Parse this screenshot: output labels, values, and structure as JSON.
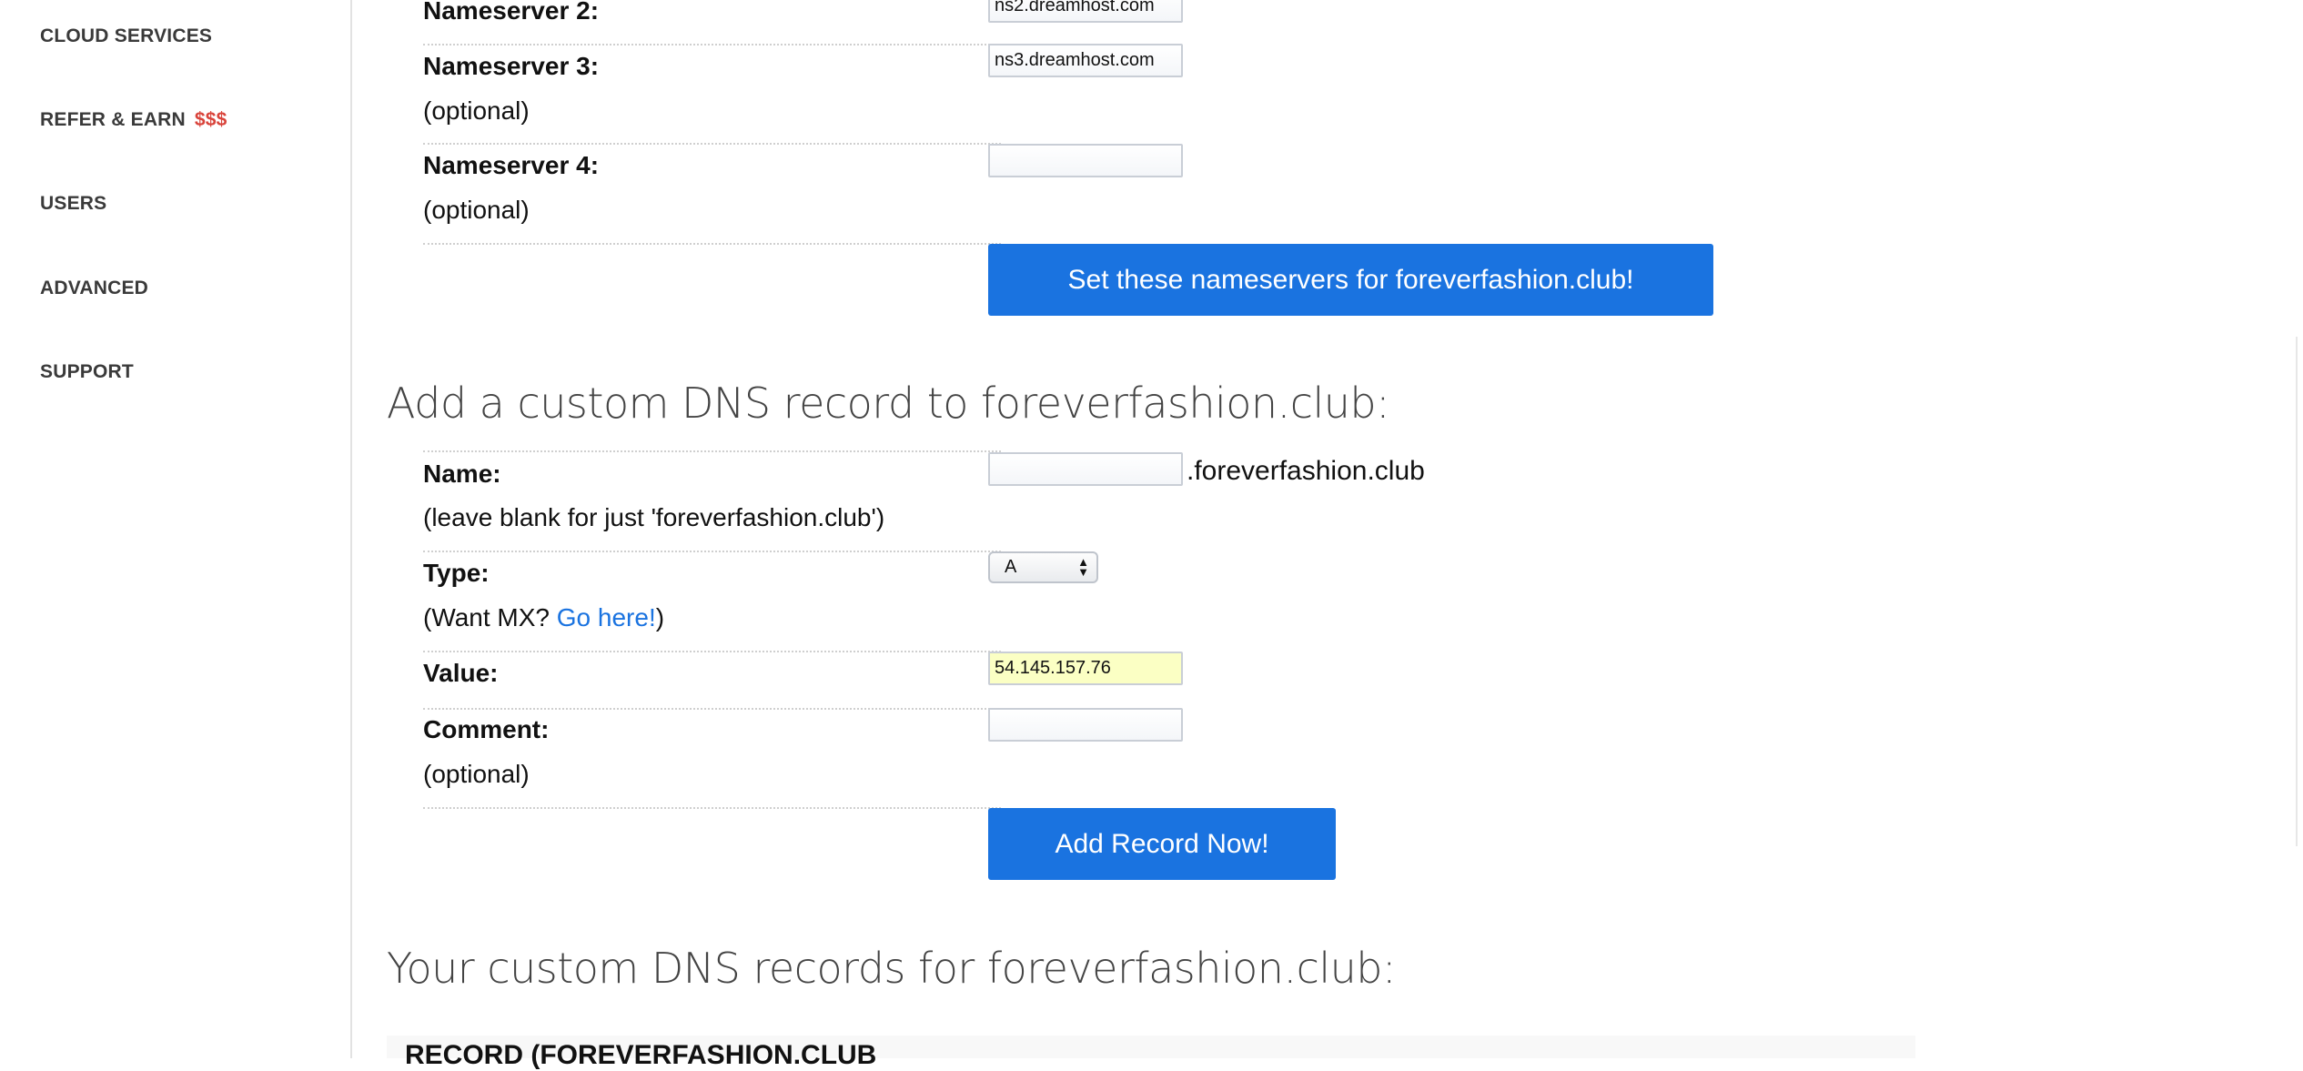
{
  "sidebar": {
    "items": [
      {
        "label": "CLOUD SERVICES"
      },
      {
        "label": "REFER & EARN",
        "accent": "$$$"
      },
      {
        "label": "USERS"
      },
      {
        "label": "ADVANCED"
      },
      {
        "label": "SUPPORT"
      }
    ]
  },
  "nameservers": {
    "ns2": {
      "label": "Nameserver 2:",
      "value": "ns2.dreamhost.com"
    },
    "ns3": {
      "label": "Nameserver 3:",
      "sub": "(optional)",
      "value": "ns3.dreamhost.com"
    },
    "ns4": {
      "label": "Nameserver 4:",
      "sub": "(optional)",
      "value": ""
    },
    "button_label": "Set these nameservers for foreverfashion.club!"
  },
  "custom_record": {
    "heading": "Add a custom DNS record to foreverfashion.club:",
    "name": {
      "label": "Name:",
      "sub": "(leave blank for just 'foreverfashion.club')",
      "value": "",
      "suffix": ".foreverfashion.club"
    },
    "type": {
      "label": "Type:",
      "sub_prefix": "(Want MX? ",
      "link": "Go here!",
      "sub_suffix": ")",
      "selected": "A"
    },
    "value": {
      "label": "Value:",
      "value": "54.145.157.76"
    },
    "comment": {
      "label": "Comment:",
      "sub": "(optional)",
      "value": ""
    },
    "button_label": "Add Record Now!"
  },
  "records": {
    "heading": "Your custom DNS records for foreverfashion.club:",
    "table_header": "RECORD (FOREVERFASHION.CLUB"
  },
  "colors": {
    "accent_blue": "#1a73e0",
    "accent_red": "#d9443b",
    "highlight_yellow": "#fbffc4"
  }
}
